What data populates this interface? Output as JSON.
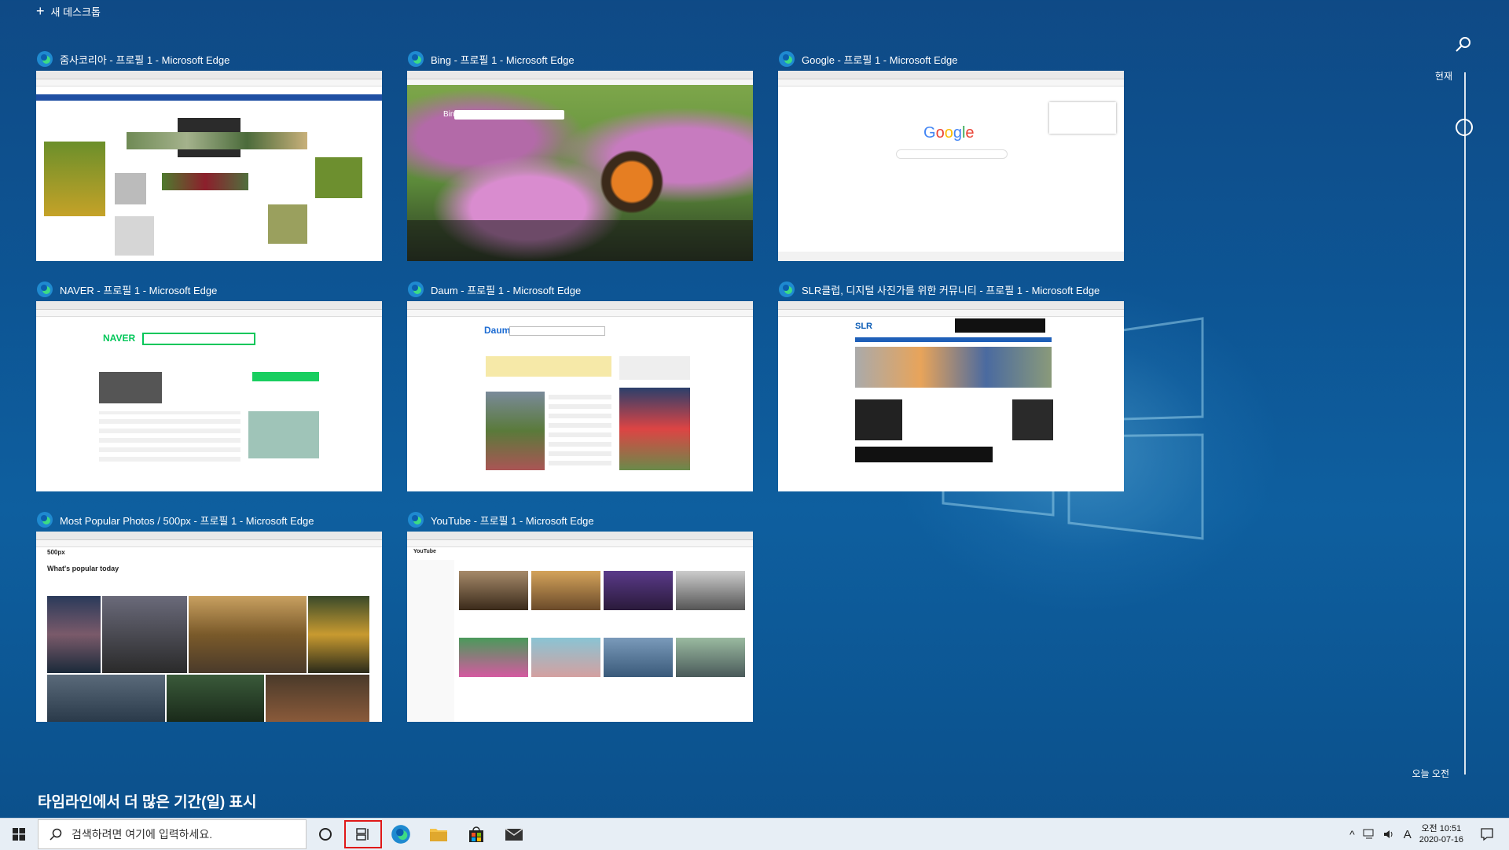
{
  "top": {
    "new_desktop_label": "새 데스크톱"
  },
  "windows": [
    {
      "title": "줌사코리아 - 프로필 1 - Microsoft Edge"
    },
    {
      "title": "Bing - 프로필 1 - Microsoft Edge",
      "site_word": "Bing"
    },
    {
      "title": "Google - 프로필 1 - Microsoft Edge",
      "site_word": "Google"
    },
    {
      "title": "NAVER - 프로필 1 - Microsoft Edge",
      "site_word": "NAVER"
    },
    {
      "title": "Daum - 프로필 1 - Microsoft Edge",
      "site_word": "Daum"
    },
    {
      "title": "SLR클럽, 디지털 사진가를 위한 커뮤니티 - 프로필 1 - Microsoft Edge",
      "site_word": "SLR"
    },
    {
      "title": "Most Popular Photos / 500px - 프로필 1 - Microsoft Edge",
      "site_word": "500px",
      "heading": "What's popular today"
    },
    {
      "title": "YouTube - 프로필 1 - Microsoft Edge",
      "site_word": "YouTube"
    }
  ],
  "timeline": {
    "now_label": "현재",
    "today_label": "오늘 오전",
    "more_days_label": "타임라인에서 더 많은 기간(일) 표시"
  },
  "taskbar": {
    "search_placeholder": "검색하려면 여기에 입력하세요.",
    "ime": "A",
    "time": "오전 10:51",
    "date": "2020-07-16"
  },
  "colors": {
    "accent_red": "#e01818",
    "desktop": "#0d5594",
    "taskbar": "#e7eef5"
  }
}
